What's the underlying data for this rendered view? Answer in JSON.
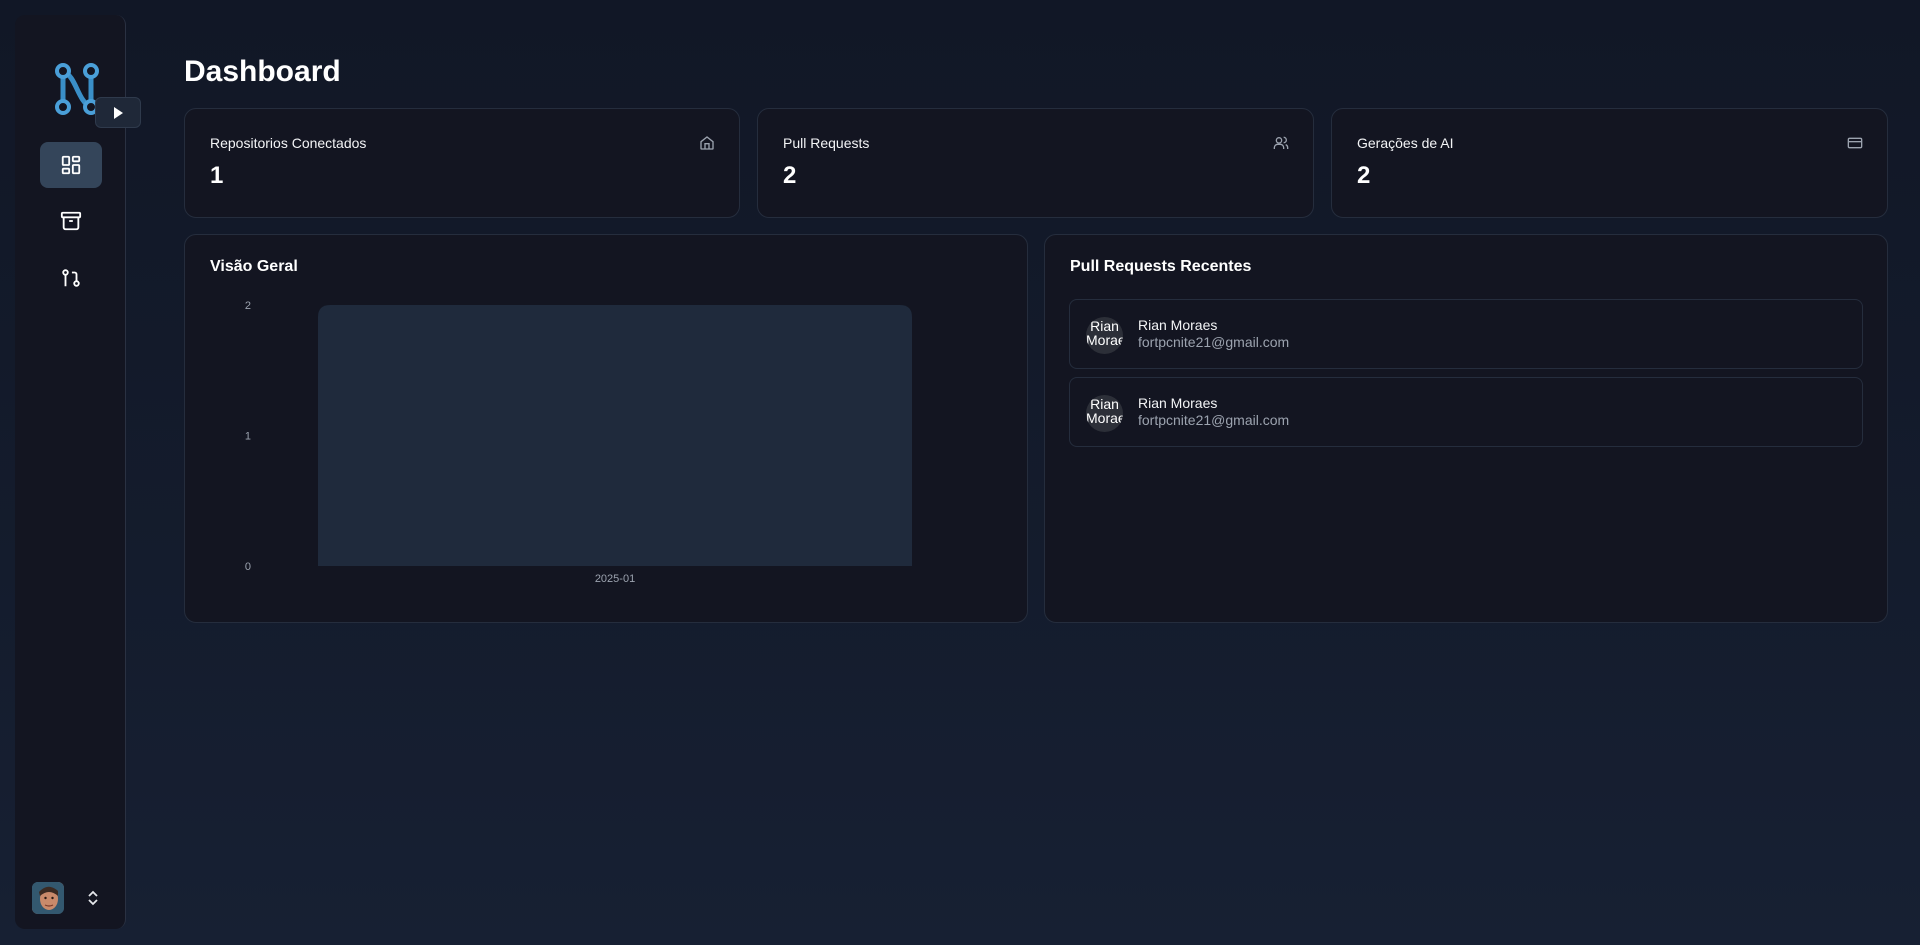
{
  "page": {
    "title": "Dashboard"
  },
  "sidebar": {
    "items": [
      {
        "icon": "dashboard-icon",
        "active": true
      },
      {
        "icon": "archive-icon",
        "active": false
      },
      {
        "icon": "git-pull-request-icon",
        "active": false
      }
    ],
    "toggle_icon": "play-arrow-icon",
    "profile_chevron_icon": "chevrons-up-down-icon"
  },
  "stats": [
    {
      "title": "Repositorios Conectados",
      "value": "1",
      "icon": "home-icon"
    },
    {
      "title": "Pull Requests",
      "value": "2",
      "icon": "users-icon"
    },
    {
      "title": "Gerações de AI",
      "value": "2",
      "icon": "credit-card-icon"
    }
  ],
  "overview": {
    "title": "Visão Geral"
  },
  "chart_data": {
    "type": "bar",
    "categories": [
      "2025-01"
    ],
    "values": [
      2
    ],
    "ylim": [
      0,
      2
    ],
    "yticks": [
      "0",
      "1",
      "2"
    ],
    "bar_color": "#1f2a3c",
    "grid": false
  },
  "recent_prs": {
    "title": "Pull Requests Recentes",
    "items": [
      {
        "avatar_text": "Rian Moraes",
        "name": "Rian Moraes",
        "email": "fortpcnite21@gmail.com"
      },
      {
        "avatar_text": "Rian Moraes",
        "name": "Rian Moraes",
        "email": "fortpcnite21@gmail.com"
      }
    ]
  },
  "colors": {
    "background": "#111726",
    "card": "#131521",
    "accent": "#4a9fd8",
    "active_nav": "#34455a"
  }
}
